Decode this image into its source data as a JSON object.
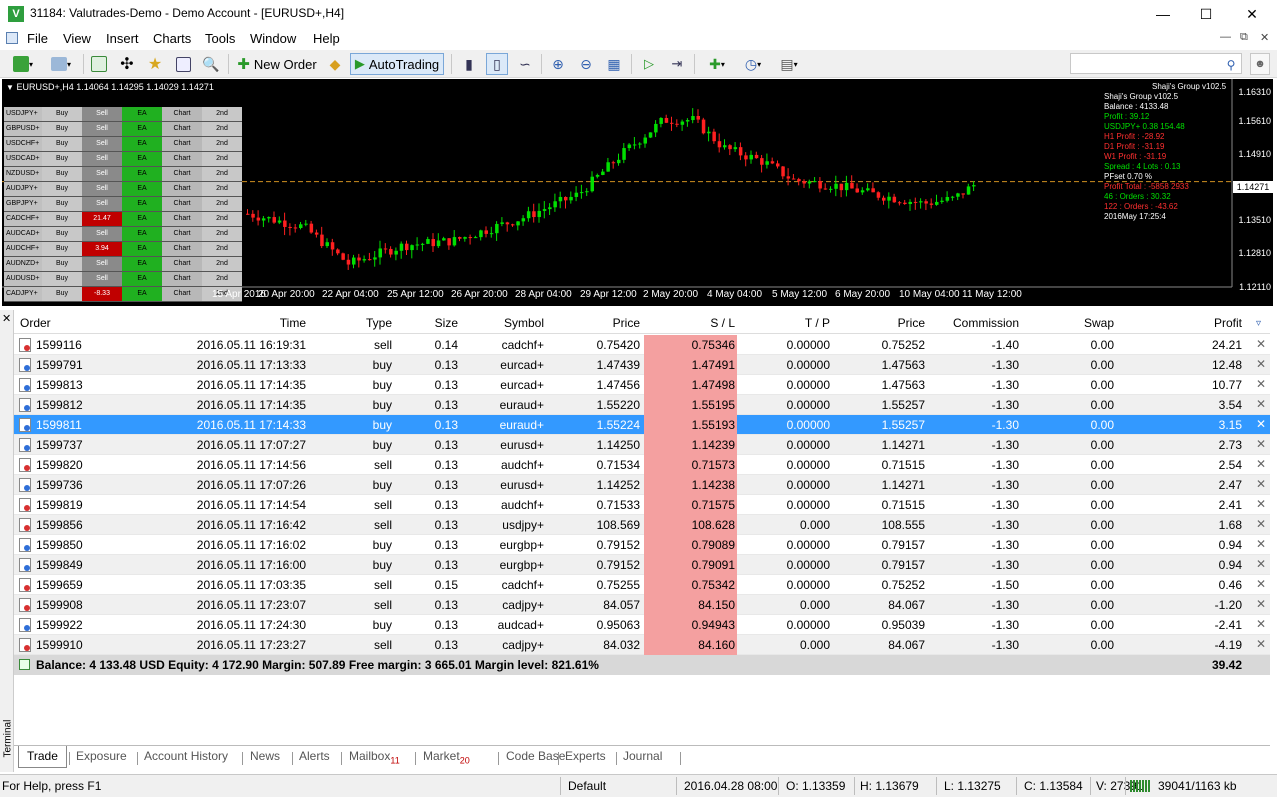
{
  "window": {
    "title": "31184: Valutrades-Demo - Demo Account - [EURUSD+,H4]",
    "app_icon": "V"
  },
  "menu": [
    "File",
    "View",
    "Insert",
    "Charts",
    "Tools",
    "Window",
    "Help"
  ],
  "toolbar": {
    "new_order": "New Order",
    "autotrading": "AutoTrading"
  },
  "chart": {
    "symbol_line": "EURUSD+,H4  1.14064 1.14295 1.14029 1.14271",
    "price_axis": [
      "1.16310",
      "1.15610",
      "1.14910",
      "1.14271",
      "1.13510",
      "1.12810",
      "1.12110"
    ],
    "current_price": "1.14271",
    "time_axis": [
      "15 Apr 2016",
      "20 Apr 20:00",
      "22 Apr 04:00",
      "25 Apr 12:00",
      "26 Apr 20:00",
      "28 Apr 04:00",
      "29 Apr 12:00",
      "2 May 20:00",
      "4 May 04:00",
      "5 May 12:00",
      "6 May 20:00",
      "10 May 04:00",
      "11 May 12:00"
    ],
    "pair_panel": [
      {
        "sym": "USDJPY+",
        "buy": "Buy",
        "sell": "Sell",
        "ea": "EA",
        "chart": "Chart",
        "nd": "2nd",
        "sell_color": "#8a8a8a"
      },
      {
        "sym": "GBPUSD+",
        "buy": "Buy",
        "sell": "Sell",
        "ea": "EA",
        "chart": "Chart",
        "nd": "2nd",
        "sell_color": "#8a8a8a"
      },
      {
        "sym": "USDCHF+",
        "buy": "Buy",
        "sell": "Sell",
        "ea": "EA",
        "chart": "Chart",
        "nd": "2nd",
        "sell_color": "#8a8a8a"
      },
      {
        "sym": "USDCAD+",
        "buy": "Buy",
        "sell": "Sell",
        "ea": "EA",
        "chart": "Chart",
        "nd": "2nd",
        "sell_color": "#8a8a8a"
      },
      {
        "sym": "NZDUSD+",
        "buy": "Buy",
        "sell": "Sell",
        "ea": "EA",
        "chart": "Chart",
        "nd": "2nd",
        "sell_color": "#8a8a8a"
      },
      {
        "sym": "AUDJPY+",
        "buy": "Buy",
        "sell": "Sell",
        "ea": "EA",
        "chart": "Chart",
        "nd": "2nd",
        "sell_color": "#8a8a8a"
      },
      {
        "sym": "GBPJPY+",
        "buy": "Buy",
        "sell": "Sell",
        "ea": "EA",
        "chart": "Chart",
        "nd": "2nd",
        "sell_color": "#8a8a8a"
      },
      {
        "sym": "CADCHF+",
        "buy": "Buy",
        "sell": "21.47",
        "ea": "EA",
        "chart": "Chart",
        "nd": "2nd",
        "sell_color": "#c00000"
      },
      {
        "sym": "AUDCAD+",
        "buy": "Buy",
        "sell": "Sell",
        "ea": "EA",
        "chart": "Chart",
        "nd": "2nd",
        "sell_color": "#8a8a8a"
      },
      {
        "sym": "AUDCHF+",
        "buy": "Buy",
        "sell": "3.94",
        "ea": "EA",
        "chart": "Chart",
        "nd": "2nd",
        "sell_color": "#c00000"
      },
      {
        "sym": "AUDNZD+",
        "buy": "Buy",
        "sell": "Sell",
        "ea": "EA",
        "chart": "Chart",
        "nd": "2nd",
        "sell_color": "#8a8a8a"
      },
      {
        "sym": "AUDUSD+",
        "buy": "Buy",
        "sell": "Sell",
        "ea": "EA",
        "chart": "Chart",
        "nd": "2nd",
        "sell_color": "#8a8a8a"
      },
      {
        "sym": "CADJPY+",
        "buy": "Buy",
        "sell": "-8.33",
        "ea": "EA",
        "chart": "Chart",
        "nd": "2nd",
        "sell_color": "#c00000"
      }
    ],
    "info_panel": [
      {
        "text": "Shaji's Group v102.5",
        "color": "#ffffff"
      },
      {
        "text": "Shaji's Group v102.5",
        "color": "#ffffff"
      },
      {
        "text": "Balance :   4133.48",
        "color": "#ffffff"
      },
      {
        "text": "Profit :   39.12",
        "color": "#00e000"
      },
      {
        "text": "USDJPY+ 0.38     154.48",
        "color": "#00e000"
      },
      {
        "text": "H1 Profit :  -28.92",
        "color": "#ff3030"
      },
      {
        "text": "D1 Profit :  -31.19",
        "color": "#ff3030"
      },
      {
        "text": "W1 Profit :  -31.19",
        "color": "#ff3030"
      },
      {
        "text": "Spread :  4    Lots :      0.13",
        "color": "#00e000"
      },
      {
        "text": "PFset 0.70 %",
        "color": "#ffffff"
      },
      {
        "text": "Profit Total : -5858     2933",
        "color": "#ff3030"
      },
      {
        "text": "46 : Orders : 30.32",
        "color": "#00e000"
      },
      {
        "text": "122 : Orders : -43.62",
        "color": "#ff3030"
      },
      {
        "text": "2016May 17:25:4",
        "color": "#ffffff"
      }
    ]
  },
  "table": {
    "headers": [
      "Order",
      "Time",
      "Type",
      "Size",
      "Symbol",
      "Price",
      "S / L",
      "T / P",
      "Price",
      "Commission",
      "Swap",
      "Profit"
    ],
    "rows": [
      [
        "1599116",
        "2016.05.11 16:19:31",
        "sell",
        "0.14",
        "cadchf+",
        "0.75420",
        "0.75346",
        "0.00000",
        "0.75252",
        "-1.40",
        "0.00",
        "24.21"
      ],
      [
        "1599791",
        "2016.05.11 17:13:33",
        "buy",
        "0.13",
        "eurcad+",
        "1.47439",
        "1.47491",
        "0.00000",
        "1.47563",
        "-1.30",
        "0.00",
        "12.48"
      ],
      [
        "1599813",
        "2016.05.11 17:14:35",
        "buy",
        "0.13",
        "eurcad+",
        "1.47456",
        "1.47498",
        "0.00000",
        "1.47563",
        "-1.30",
        "0.00",
        "10.77"
      ],
      [
        "1599812",
        "2016.05.11 17:14:35",
        "buy",
        "0.13",
        "euraud+",
        "1.55220",
        "1.55195",
        "0.00000",
        "1.55257",
        "-1.30",
        "0.00",
        "3.54"
      ],
      [
        "1599811",
        "2016.05.11 17:14:33",
        "buy",
        "0.13",
        "euraud+",
        "1.55224",
        "1.55193",
        "0.00000",
        "1.55257",
        "-1.30",
        "0.00",
        "3.15"
      ],
      [
        "1599737",
        "2016.05.11 17:07:27",
        "buy",
        "0.13",
        "eurusd+",
        "1.14250",
        "1.14239",
        "0.00000",
        "1.14271",
        "-1.30",
        "0.00",
        "2.73"
      ],
      [
        "1599820",
        "2016.05.11 17:14:56",
        "sell",
        "0.13",
        "audchf+",
        "0.71534",
        "0.71573",
        "0.00000",
        "0.71515",
        "-1.30",
        "0.00",
        "2.54"
      ],
      [
        "1599736",
        "2016.05.11 17:07:26",
        "buy",
        "0.13",
        "eurusd+",
        "1.14252",
        "1.14238",
        "0.00000",
        "1.14271",
        "-1.30",
        "0.00",
        "2.47"
      ],
      [
        "1599819",
        "2016.05.11 17:14:54",
        "sell",
        "0.13",
        "audchf+",
        "0.71533",
        "0.71575",
        "0.00000",
        "0.71515",
        "-1.30",
        "0.00",
        "2.41"
      ],
      [
        "1599856",
        "2016.05.11 17:16:42",
        "sell",
        "0.13",
        "usdjpy+",
        "108.569",
        "108.628",
        "0.000",
        "108.555",
        "-1.30",
        "0.00",
        "1.68"
      ],
      [
        "1599850",
        "2016.05.11 17:16:02",
        "buy",
        "0.13",
        "eurgbp+",
        "0.79152",
        "0.79089",
        "0.00000",
        "0.79157",
        "-1.30",
        "0.00",
        "0.94"
      ],
      [
        "1599849",
        "2016.05.11 17:16:00",
        "buy",
        "0.13",
        "eurgbp+",
        "0.79152",
        "0.79091",
        "0.00000",
        "0.79157",
        "-1.30",
        "0.00",
        "0.94"
      ],
      [
        "1599659",
        "2016.05.11 17:03:35",
        "sell",
        "0.15",
        "cadchf+",
        "0.75255",
        "0.75342",
        "0.00000",
        "0.75252",
        "-1.50",
        "0.00",
        "0.46"
      ],
      [
        "1599908",
        "2016.05.11 17:23:07",
        "sell",
        "0.13",
        "cadjpy+",
        "84.057",
        "84.150",
        "0.000",
        "84.067",
        "-1.30",
        "0.00",
        "-1.20"
      ],
      [
        "1599922",
        "2016.05.11 17:24:30",
        "buy",
        "0.13",
        "audcad+",
        "0.95063",
        "0.94943",
        "0.00000",
        "0.95039",
        "-1.30",
        "0.00",
        "-2.41"
      ],
      [
        "1599910",
        "2016.05.11 17:23:27",
        "sell",
        "0.13",
        "cadjpy+",
        "84.032",
        "84.160",
        "0.000",
        "84.067",
        "-1.30",
        "0.00",
        "-4.19"
      ]
    ],
    "selected_row": 4,
    "summary": "Balance: 4 133.48 USD  Equity: 4 172.90  Margin: 507.89  Free margin: 3 665.01  Margin level: 821.61%",
    "summary_profit": "39.42"
  },
  "terminal_label": "Terminal",
  "tabs": [
    {
      "label": "Trade",
      "badge": ""
    },
    {
      "label": "Exposure",
      "badge": ""
    },
    {
      "label": "Account History",
      "badge": ""
    },
    {
      "label": "News",
      "badge": ""
    },
    {
      "label": "Alerts",
      "badge": ""
    },
    {
      "label": "Mailbox",
      "badge": "11"
    },
    {
      "label": "Market",
      "badge": "20"
    },
    {
      "label": "Code Base",
      "badge": ""
    },
    {
      "label": "Experts",
      "badge": ""
    },
    {
      "label": "Journal",
      "badge": ""
    }
  ],
  "status": {
    "help": "For Help, press F1",
    "profile": "Default",
    "datetime": "2016.04.28 08:00",
    "open": "O: 1.13359",
    "high": "H: 1.13679",
    "low": "L: 1.13275",
    "close": "C: 1.13584",
    "volume": "V: 27391",
    "traffic": "39041/1163 kb"
  },
  "colors": {
    "bull": "#00e000",
    "bear": "#ff2020",
    "chart_bg": "#000000",
    "selection": "#3399ff",
    "sl_fill": "#f4a0a0"
  }
}
